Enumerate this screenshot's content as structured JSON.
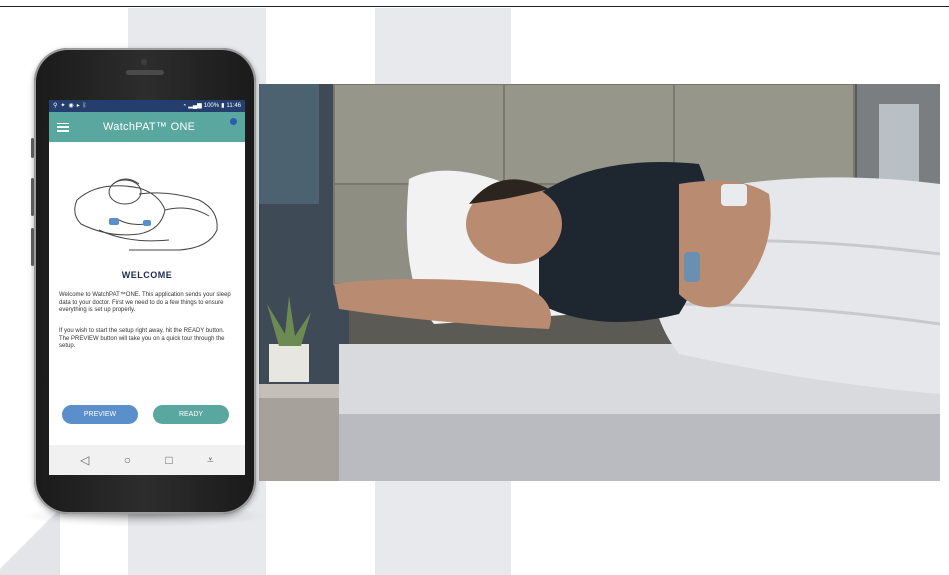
{
  "phone": {
    "status_bar": {
      "battery": "100%",
      "time": "11:46"
    },
    "app_title": "WatchPAT™ ONE",
    "welcome_title": "WELCOME",
    "paragraph_1": "Welcome to WatchPAT™ONE. This application sends your sleep data to your doctor. First we need to do a few things to ensure everything is set up properly.",
    "paragraph_2": "If you wish to start the setup right away, hit the READY button. The PREVIEW button will take you on a quick tour through the setup.",
    "buttons": {
      "preview": "PREVIEW",
      "ready": "READY"
    },
    "nav_icons": [
      "back-icon",
      "home-icon",
      "recents-icon",
      "collapse-icon"
    ]
  },
  "colors": {
    "status_bar": "#243e6e",
    "app_bar": "#5aa7a0",
    "preview_button": "#5a8fcb",
    "ready_button": "#5aa7a0",
    "welcome_title": "#1d2b50"
  }
}
